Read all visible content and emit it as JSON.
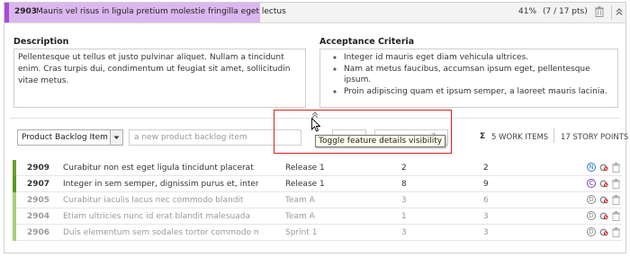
{
  "feature": {
    "id": "2903",
    "title": "Mauris vel risus in ligula pretium molestie fringilla eget lectus",
    "progress_percent": "41%",
    "progress_points": "(7 / 17 pts)",
    "color": "#a64dd6"
  },
  "description": {
    "label": "Description",
    "text": "Pellentesque ut tellus et justo pulvinar aliquet. Nullam a tincidunt enim. Cras turpis dui, condimentum ut feugiat sit amet, sollicitudin vitae metus."
  },
  "acceptance": {
    "label": "Acceptance Criteria",
    "items": [
      "Integer id mauris eget diam vehicula ultrices.",
      "Nam at metus faucibus, accumsan ipsum eget, pellentesque ipsum.",
      "Proin adipiscing quam et ipsum semper, a laoreet mauris lacinia."
    ]
  },
  "toolbar": {
    "type_select": "Product Backlog Item",
    "add_placeholder": "a new product backlog item",
    "details_button_tail": "ils",
    "tooltip": "Toggle feature details visibility",
    "work_items": "5 WORK ITEMS",
    "story_points": "17 STORY POINTS",
    "sigma": "Σ"
  },
  "rows": [
    {
      "id": "2909",
      "title": "Curabitur non est eget ligula tincidunt placerat",
      "iteration": "Release 1",
      "effort": "2",
      "value": "2",
      "state": "N",
      "bar_color": "#6aa12b",
      "dim": false
    },
    {
      "id": "2907",
      "title": "Integer in sem semper, dignissim purus et, interdum erat",
      "iteration": "Release 1",
      "effort": "8",
      "value": "9",
      "state": "C",
      "bar_color": "#5a9a1f",
      "dim": false
    },
    {
      "id": "2905",
      "title": "Curabitur iaculis lacus nec commodo blandit",
      "iteration": "Team A",
      "effort": "3",
      "value": "6",
      "state": "D",
      "bar_color": "#a8cf7a",
      "dim": true
    },
    {
      "id": "2904",
      "title": "Etiam ultricies nunc id erat blandit malesuada",
      "iteration": "Team A",
      "effort": "1",
      "value": "3",
      "state": "D",
      "bar_color": "#a8cf7a",
      "dim": true
    },
    {
      "id": "2906",
      "title": "Duis elementum sem sodales tortor commodo molestie",
      "iteration": "Sprint 1",
      "effort": "3",
      "value": "3",
      "state": "D",
      "bar_color": "#a8cf7a",
      "dim": true
    }
  ]
}
